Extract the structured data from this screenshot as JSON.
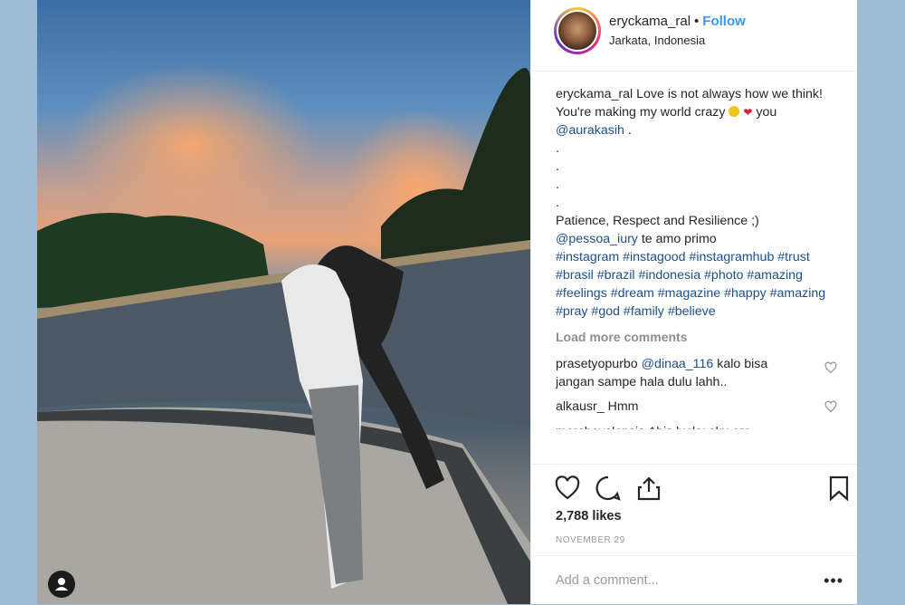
{
  "post": {
    "username": "eryckama_ral",
    "separator": "•",
    "follow_label": "Follow",
    "location": "Jarkata, Indonesia"
  },
  "caption": {
    "username": "eryckama_ral",
    "line1": "Love is not always how we think!",
    "line2_text": "You're making my world crazy",
    "line2_after": "you",
    "mention": "@aurakasih",
    "mention_after": ".",
    "dots": [
      ".",
      ".",
      ".",
      "."
    ],
    "line3": "Patience, Respect and Resilience ;)",
    "mention2": "@pessoa_iury",
    "mention2_after": "te amo primo",
    "hashtags": "#instagram #instagood #instagramhub #trust #brasil #brazil #indonesia #photo #amazing #feelings #dream #magazine #happy #amazing #pray #god #family #believe"
  },
  "load_more": "Load more comments",
  "comments": [
    {
      "username": "prasetyopurbo",
      "mention": "@dinaa_116",
      "text": "kalo bisa jangan sampe hala dulu lahh.."
    },
    {
      "username": "alkausr_",
      "mention": "",
      "text": "Hmm"
    }
  ],
  "partial_comment": "morebeyalensia     Abis lucky aku om",
  "likes": "2,788 likes",
  "date": "NOVEMBER 29",
  "add_comment_placeholder": "Add a comment...",
  "more_glyph": "•••",
  "icons": [
    "heart-icon",
    "comment-icon",
    "share-icon",
    "bookmark-icon",
    "user-tag-icon"
  ],
  "colors": {
    "link": "#1d4e8a",
    "follow": "#3897f0",
    "background": "#9fbcd6"
  }
}
